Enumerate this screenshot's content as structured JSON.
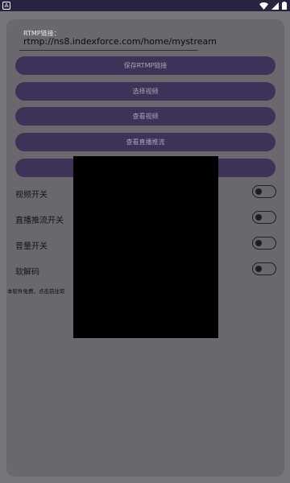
{
  "status_bar": {
    "left_icon_text": "A",
    "icons": [
      "wifi-icon",
      "signal-icon",
      "battery-icon"
    ]
  },
  "rtmp": {
    "label": "RTMP链接：",
    "value": "rtmp://ns8.indexforce.com/home/mystream"
  },
  "buttons": {
    "save_rtmp": "保存RTMP链接",
    "choose_video": "选择视频",
    "view_video": "查看视频",
    "view_live": "查看直播推流",
    "hidden_button": ""
  },
  "toggles": [
    {
      "label": "视频开关",
      "on": false
    },
    {
      "label": "直播推流开关",
      "on": false
    },
    {
      "label": "音量开关",
      "on": false
    },
    {
      "label": "软解码",
      "on": false
    }
  ],
  "footer_note": "本软件免费，点击前往软",
  "colors": {
    "status_bar": "#2a2340",
    "button_bg": "#3d3258",
    "panel_bg": "#6a686e",
    "page_bg": "#77757b"
  }
}
